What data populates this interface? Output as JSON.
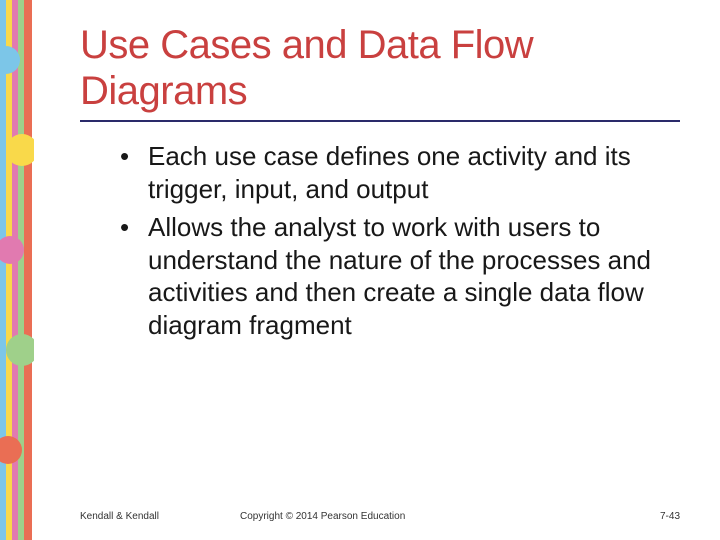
{
  "deco": {
    "colors": [
      "#7cc6e8",
      "#f9d94a",
      "#e17ab0",
      "#9fd08a",
      "#ea6e54"
    ]
  },
  "title": "Use Cases and Data Flow Diagrams",
  "bullets": [
    "Each use case defines one activity and its trigger, input, and output",
    "Allows the analyst to work with users to understand the nature of the processes and activities and then create a single data flow diagram fragment"
  ],
  "footer": {
    "author": "Kendall & Kendall",
    "copyright": "Copyright © 2014 Pearson Education",
    "page": "7-43"
  }
}
